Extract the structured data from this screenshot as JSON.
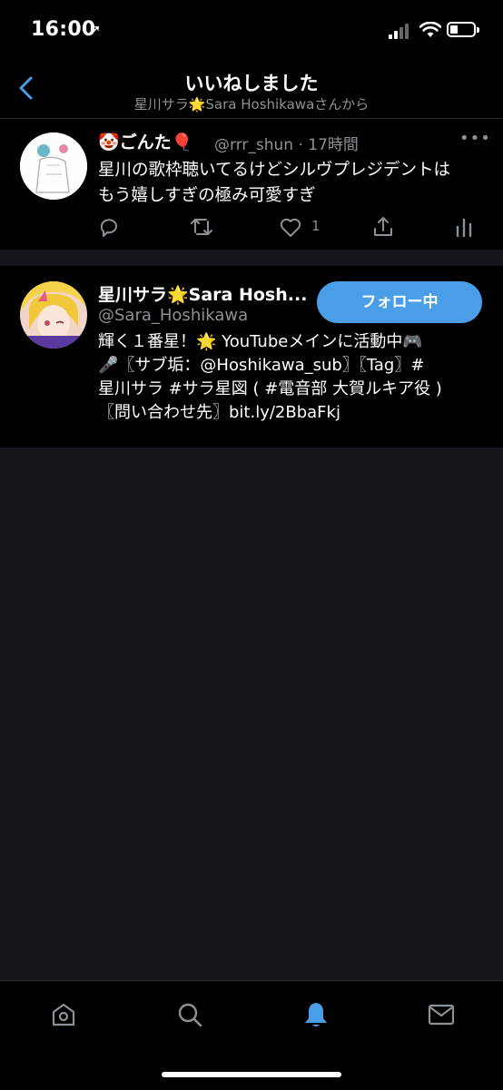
{
  "status_bar": {
    "time": "16:00",
    "location_glyph": "➚"
  },
  "header": {
    "title": "いいねしました",
    "subtitle": "星川サラ🌟Sara Hoshikawaさんから"
  },
  "tweet": {
    "display_name": "🤡ごんた🎈",
    "handle_time": "@rrr_shun · 17時間",
    "more": "•••",
    "line1": "星川の歌枠聴いてるけどシルヴプレジデントは",
    "line2": "もう嬉しすぎの極み可愛すぎ",
    "like_count": "1"
  },
  "profile": {
    "display_name": "星川サラ🌟Sara Hosh...",
    "handle": "@Sara_Hoshikawa",
    "follow_label": "フォロー中",
    "bio_line1": "輝く１番星！🌟 YouTubeメインに活動中🎮",
    "bio_line2": "🎤〖サブ垢：@Hoshikawa_sub〗〖Tag〗#",
    "bio_line3": "星川サラ #サラ星図 ( #電音部 大賀ルキア役 )",
    "bio_line4": "〖問い合わせ先〗bit.ly/2BbaFkj"
  },
  "colors": {
    "accent": "#4a9ee8",
    "background": "#15161a",
    "secondary_text": "#8b9196"
  },
  "icons": [
    "back-chevron-icon",
    "reply-icon",
    "retweet-icon",
    "like-icon",
    "share-icon",
    "analytics-icon",
    "home-icon",
    "search-icon",
    "notifications-icon",
    "messages-icon"
  ]
}
